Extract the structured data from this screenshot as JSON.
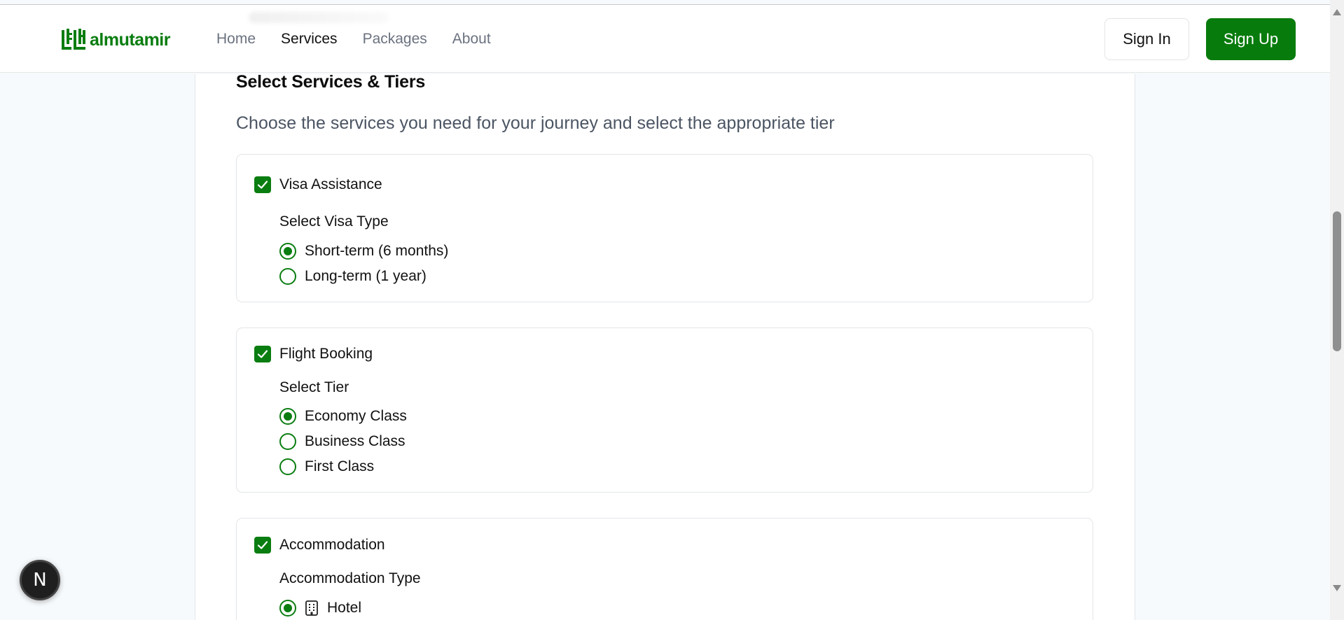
{
  "header": {
    "logo_text": "almutamir",
    "nav": [
      "Home",
      "Services",
      "Packages",
      "About"
    ],
    "active_nav": "Services",
    "sign_in": "Sign In",
    "sign_up": "Sign Up"
  },
  "section": {
    "title": "Select Services & Tiers",
    "description": "Choose the services you need for your journey and select the appropriate tier"
  },
  "services": [
    {
      "name": "Visa Assistance",
      "checked": true,
      "sub_label": "Select Visa Type",
      "options": [
        {
          "label": "Short-term (6 months)",
          "selected": true
        },
        {
          "label": "Long-term (1 year)",
          "selected": false
        }
      ]
    },
    {
      "name": "Flight Booking",
      "checked": true,
      "sub_label": "Select Tier",
      "options": [
        {
          "label": "Economy Class",
          "selected": true
        },
        {
          "label": "Business Class",
          "selected": false
        },
        {
          "label": "First Class",
          "selected": false
        }
      ]
    },
    {
      "name": "Accommodation",
      "checked": true,
      "sub_label": "Accommodation Type",
      "options": [
        {
          "label": "Hotel",
          "selected": true,
          "icon": "building-icon"
        }
      ]
    }
  ],
  "floating_button": {
    "label": "N"
  },
  "colors": {
    "brand_green": "#0a7d10",
    "muted_text": "#4b5563"
  }
}
